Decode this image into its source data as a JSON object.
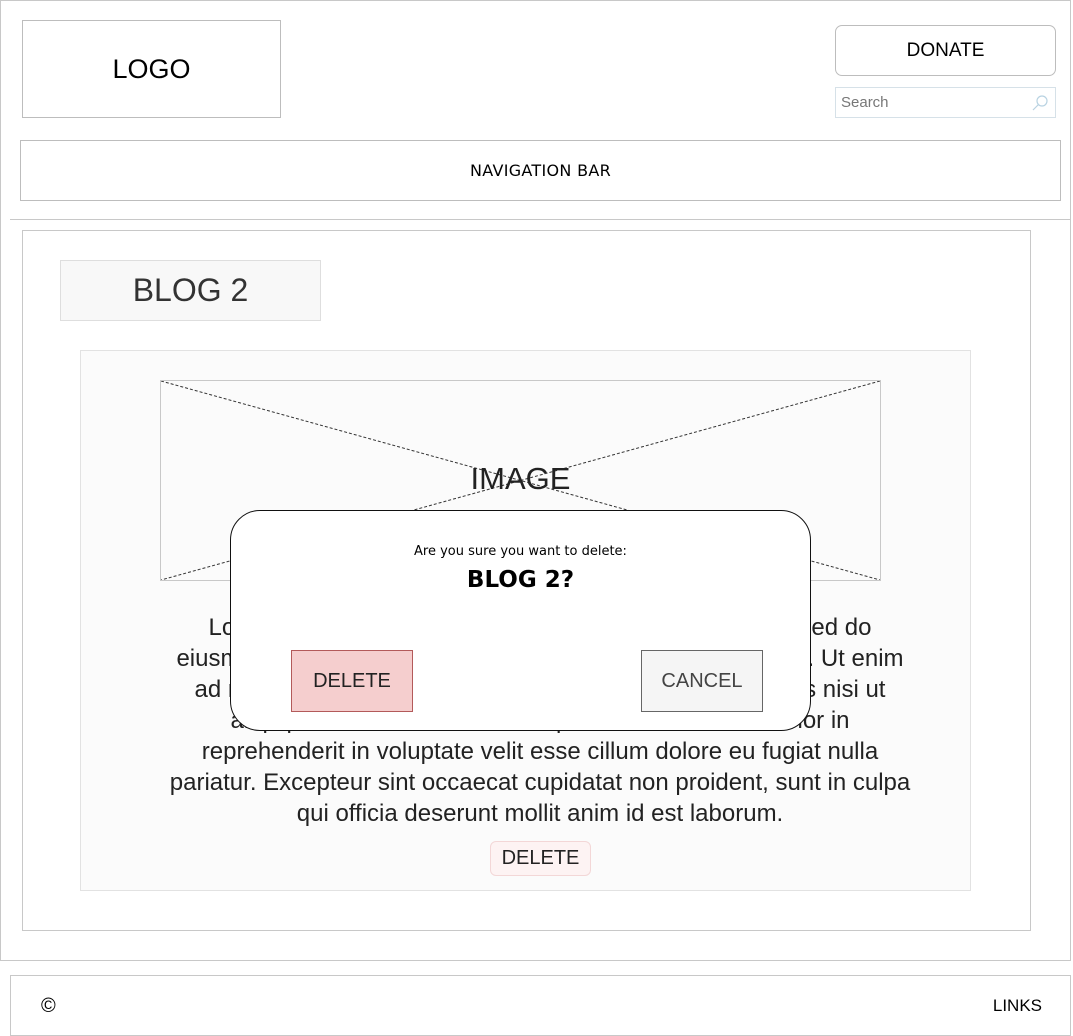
{
  "header": {
    "logo_text": "LOGO",
    "donate_label": "DONATE",
    "search": {
      "placeholder": "Search",
      "value": ""
    },
    "nav_label": "NAVIGATION BAR"
  },
  "post": {
    "title": "BLOG 2",
    "image_label": "IMAGE",
    "body": "Lorem ipsum dolor sit amet, consectetur adipiscing elit, sed do eiusmod tempor incididunt ut labore et dolore magna aliqua. Ut enim ad minim veniam, quis nostrud exercitation ullamco laboris nisi ut aliquip ex ea commodo consequat. Duis aute irure dolor in reprehenderit in voluptate velit esse cillum dolore eu fugiat nulla pariatur. Excepteur sint occaecat cupidatat non proident, sunt in culpa qui officia deserunt mollit anim id est laborum.",
    "delete_label": "DELETE"
  },
  "dialog": {
    "question": "Are you sure you want to delete:",
    "target": "BLOG 2?",
    "delete_label": "DELETE",
    "cancel_label": "CANCEL"
  },
  "footer": {
    "copyright_symbol": "©",
    "links_label": "LINKS"
  },
  "icons": {
    "search": "search-icon",
    "copyright": "copyright-icon",
    "image": "image-placeholder-icon"
  },
  "colors": {
    "dialog_delete_bg": "#f5cece",
    "dialog_delete_border": "#b35a5a",
    "post_delete_bg": "#fdf3f3",
    "border_gray": "#c8c8c8"
  }
}
